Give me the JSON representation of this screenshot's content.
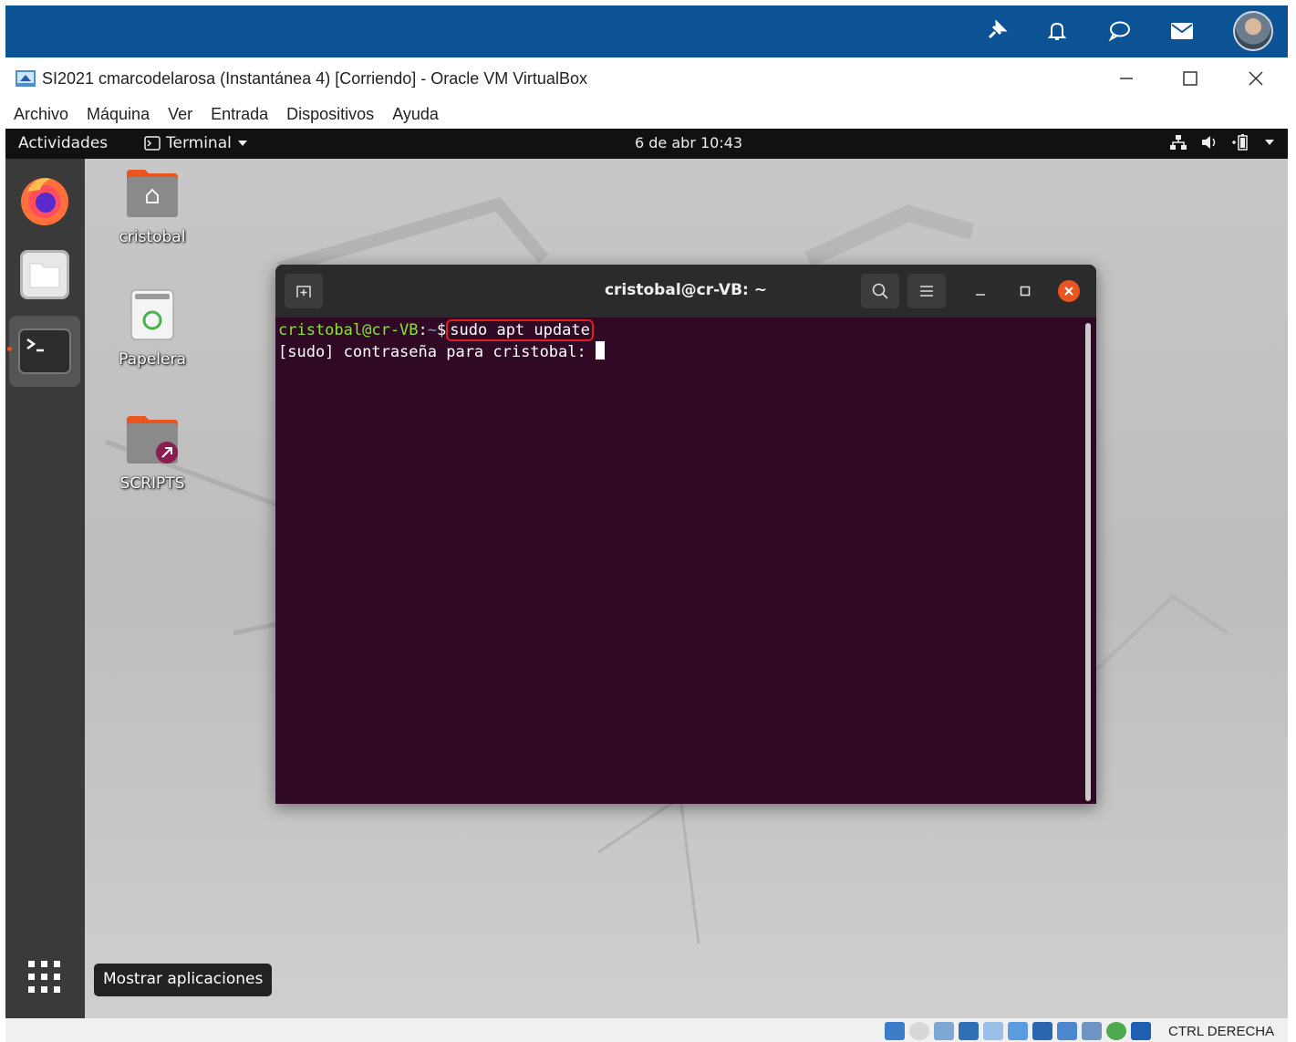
{
  "window": {
    "title": "SI2021 cmarcodelarosa (Instantánea 4) [Corriendo] - Oracle VM VirtualBox"
  },
  "menu": {
    "items": [
      {
        "label": "Archivo"
      },
      {
        "label": "Máquina"
      },
      {
        "label": "Ver"
      },
      {
        "label": "Entrada"
      },
      {
        "label": "Dispositivos"
      },
      {
        "label": "Ayuda"
      }
    ]
  },
  "ubuntu_topbar": {
    "activities": "Actividades",
    "app_menu": "Terminal",
    "clock": "6 de abr  10:43"
  },
  "desktop_icons": [
    {
      "label": "cristobal",
      "icon": "home-folder-icon"
    },
    {
      "label": "Papelera",
      "icon": "trash-icon"
    },
    {
      "label": "SCRIPTS",
      "icon": "folder-link-icon"
    }
  ],
  "dock": {
    "items": [
      "firefox-icon",
      "files-icon",
      "terminal-icon"
    ],
    "show_apps_tooltip": "Mostrar aplicaciones"
  },
  "terminal": {
    "title": "cristobal@cr-VB: ~",
    "prompt_user": "cristobal@cr-VB",
    "prompt_path": "~",
    "prompt_symbol": "$",
    "command": "sudo apt update",
    "line2": "[sudo] contraseña para cristobal: "
  },
  "statusbar": {
    "host_key": "CTRL DERECHA"
  },
  "colors": {
    "host_bar": "#0b5394",
    "terminal_bg": "#300a24",
    "accent": "#e95420",
    "highlight": "#e01b24"
  }
}
